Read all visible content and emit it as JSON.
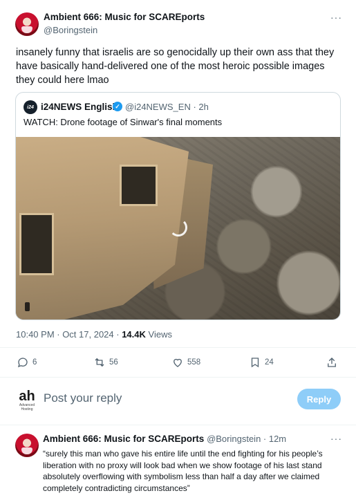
{
  "main_tweet": {
    "author_name": "Ambient 666: Music for SCAREports",
    "handle": "@Boringstein",
    "more_label": "···",
    "text": "insanely funny that israelis are so genocidally up their own ass that they have basically hand-delivered one of the most heroic possible images they could here lmao",
    "timestamp": "10:40 PM · Oct 17, 2024 · ",
    "views_count": "14.4K",
    "views_label": " Views"
  },
  "quote": {
    "logo_text": "i24",
    "author_name": "i24NEWS English",
    "handle_time": "@i24NEWS_EN · 2h",
    "text": "WATCH: Drone footage of Sinwar's final moments"
  },
  "actions": {
    "replies": "6",
    "reposts": "56",
    "likes": "558",
    "bookmarks": "24"
  },
  "composer": {
    "logo_main": "ah",
    "logo_sub1": "Advanced",
    "logo_sub2": "Hosting",
    "placeholder": "Post your reply",
    "button_label": "Reply"
  },
  "reply": {
    "author_name": "Ambient 666: Music for SCAREports",
    "handle_time": "@Boringstein · 12m",
    "more_label": "···",
    "text": "“surely this man who gave his entire life until the end fighting for his people’s liberation with no proxy will look bad when we show footage of his last stand absolutely overflowing with symbolism  less than half a day after we claimed completely contradicting circumstances”"
  },
  "colors": {
    "accent": "#1d9bf0",
    "reply_button_disabled": "#8ecdf8",
    "muted_text": "#536471"
  }
}
